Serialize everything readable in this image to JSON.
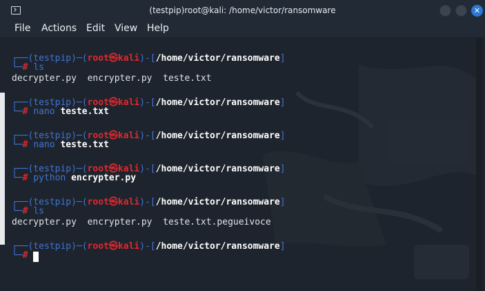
{
  "window": {
    "title": "(testpip)root@kali: /home/victor/ransomware"
  },
  "menu": {
    "items": [
      "File",
      "Actions",
      "Edit",
      "View",
      "Help"
    ]
  },
  "prompt": {
    "env": "(testpip)",
    "user": "root",
    "at": "㉿",
    "host": "kali",
    "path": "/home/victor/ransomware",
    "symbol": "#"
  },
  "session": [
    {
      "command": "ls",
      "args": "",
      "output": "decrypter.py  encrypter.py  teste.txt"
    },
    {
      "command": "nano",
      "args": "teste.txt",
      "output": ""
    },
    {
      "command": "nano",
      "args": "teste.txt",
      "output": ""
    },
    {
      "command": "python",
      "args": "encrypter.py",
      "output": ""
    },
    {
      "command": "ls",
      "args": "",
      "output": "decrypter.py  encrypter.py  teste.txt.pegueivoce"
    },
    {
      "command": "",
      "args": "",
      "output": ""
    }
  ],
  "colors": {
    "titlebar": "#212a35",
    "terminal_bg": "#1e242d",
    "prompt_blue": "#3f74d6",
    "prompt_red": "#e0282e",
    "close_button": "#2c78d4"
  },
  "icons": [
    "terminal-icon",
    "minimize-icon",
    "maximize-icon",
    "close-icon"
  ]
}
